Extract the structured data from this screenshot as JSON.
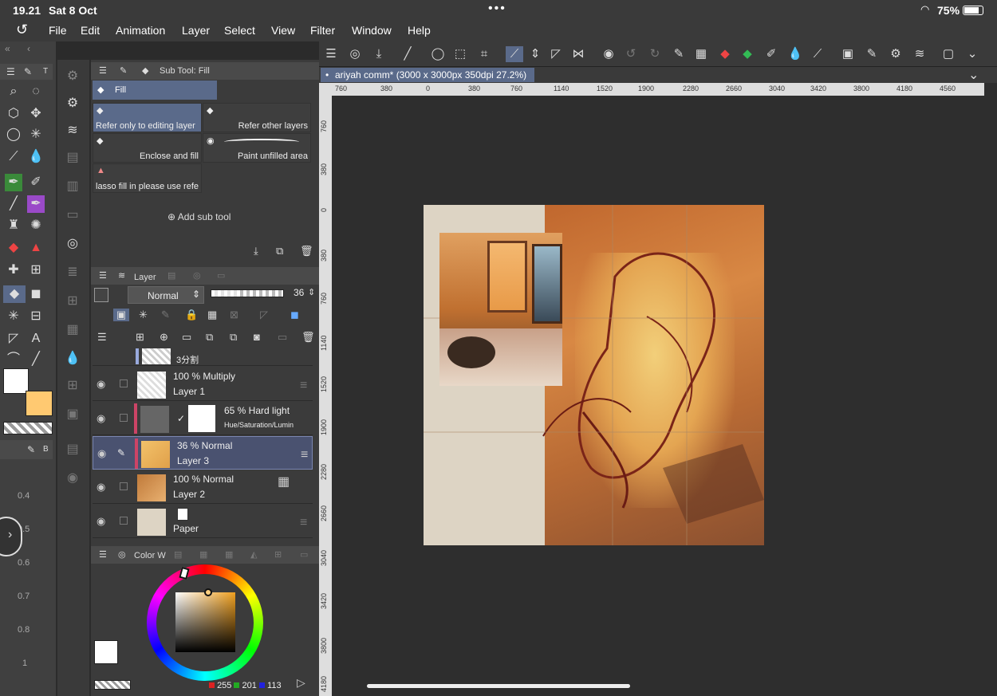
{
  "status": {
    "time": "19.21",
    "date": "Sat 8 Oct",
    "battery": "75%"
  },
  "menu": [
    "File",
    "Edit",
    "Animation",
    "Layer",
    "Select",
    "View",
    "Filter",
    "Window",
    "Help"
  ],
  "subtool": {
    "header": "Sub Tool: Fill",
    "group": "Fill",
    "items": [
      "Refer only to editing layer",
      "Refer other layers",
      "Enclose and fill",
      "Paint unfilled area",
      "lasso fill in please use refe"
    ],
    "add_label": "Add sub tool"
  },
  "layer_panel": {
    "header": "Layer",
    "blend_mode": "Normal",
    "opacity": "36",
    "layers": [
      {
        "name": "3分割",
        "info": ""
      },
      {
        "name": "Layer 1",
        "info": "100 %  Multiply"
      },
      {
        "name": "Hue/Saturation/Lumin",
        "info": "65 %  Hard light"
      },
      {
        "name": "Layer 3",
        "info": "36 %  Normal"
      },
      {
        "name": "Layer 2",
        "info": "100 %  Normal"
      },
      {
        "name": "Paper",
        "info": ""
      }
    ]
  },
  "color_panel": {
    "header": "Color W",
    "r": "255",
    "g": "201",
    "b": "113",
    "main_color": "#ffffff",
    "sub_color": "#ffc971"
  },
  "brush_sizes": [
    "0.4",
    "0.5",
    "0.6",
    "0.7",
    "0.8",
    "1"
  ],
  "brush_header": "B",
  "tool_header": "T",
  "canvas": {
    "tab_title": "ariyah comm* (3000 x 3000px 350dpi 27.2%)",
    "ruler_top": [
      "760",
      "380",
      "0",
      "380",
      "760",
      "1140",
      "1520",
      "1900",
      "2280",
      "2660",
      "3040",
      "3420",
      "3800",
      "4180",
      "4560"
    ],
    "ruler_left": [
      "760",
      "380",
      "0",
      "380",
      "760",
      "1140",
      "1520",
      "1900",
      "2280",
      "2660",
      "3040",
      "3420",
      "3800",
      "4180"
    ]
  }
}
